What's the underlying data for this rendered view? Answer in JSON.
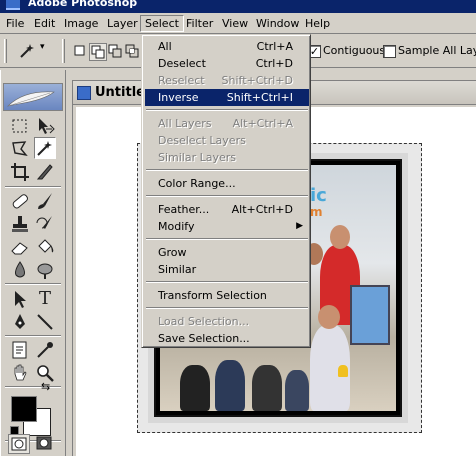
{
  "titlebar": {
    "title": "Adobe Photoshop"
  },
  "menubar": {
    "items": [
      "File",
      "Edit",
      "Image",
      "Layer",
      "Select",
      "Filter",
      "View",
      "Window",
      "Help"
    ]
  },
  "options": {
    "contiguous_label": "Contiguous",
    "contiguous_checked": "✓",
    "sample_all_label": "Sample All Layers"
  },
  "document": {
    "title": "Untitled"
  },
  "photo_text": {
    "sign_top": "ic",
    "sign_bottom": "m"
  },
  "select_menu": {
    "items": [
      {
        "label": "All",
        "shortcut": "Ctrl+A"
      },
      {
        "label": "Deselect",
        "shortcut": "Ctrl+D"
      },
      {
        "label": "Reselect",
        "shortcut": "Shift+Ctrl+D"
      },
      {
        "label": "Inverse",
        "shortcut": "Shift+Ctrl+I"
      },
      {
        "label": "All Layers",
        "shortcut": "Alt+Ctrl+A"
      },
      {
        "label": "Deselect Layers",
        "shortcut": ""
      },
      {
        "label": "Similar Layers",
        "shortcut": ""
      },
      {
        "label": "Color Range...",
        "shortcut": ""
      },
      {
        "label": "Feather...",
        "shortcut": "Alt+Ctrl+D"
      },
      {
        "label": "Modify",
        "shortcut": ""
      },
      {
        "label": "Grow",
        "shortcut": ""
      },
      {
        "label": "Similar",
        "shortcut": ""
      },
      {
        "label": "Transform Selection",
        "shortcut": ""
      },
      {
        "label": "Load Selection...",
        "shortcut": ""
      },
      {
        "label": "Save Selection...",
        "shortcut": ""
      }
    ]
  },
  "colors": {
    "menu_highlight": "#0a246a",
    "foreground_swatch": "#000000",
    "background_swatch": "#ffffff"
  },
  "icons": {
    "magic_wand": "magic-wand-icon",
    "marquee": "rectangular-marquee-icon",
    "move": "move-icon",
    "lasso": "lasso-icon",
    "crop": "crop-icon",
    "slice": "slice-icon",
    "healing": "healing-brush-icon",
    "brush": "brush-icon",
    "stamp": "clone-stamp-icon",
    "history_brush": "history-brush-icon",
    "eraser": "eraser-icon",
    "bucket": "paint-bucket-icon",
    "blur": "blur-icon",
    "dodge": "dodge-icon",
    "path_select": "path-selection-icon",
    "type": "type-icon",
    "pen": "pen-icon",
    "line": "line-icon",
    "notes": "notes-icon",
    "eyedropper": "eyedropper-icon",
    "hand": "hand-icon",
    "zoom": "zoom-icon",
    "feather_logo": "feather-logo-icon"
  }
}
